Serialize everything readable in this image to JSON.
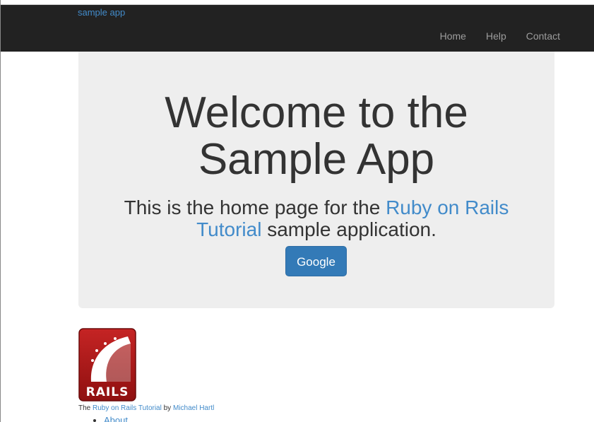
{
  "navbar": {
    "brand": "sample app",
    "links": [
      {
        "label": "Home"
      },
      {
        "label": "Help"
      },
      {
        "label": "Contact"
      }
    ]
  },
  "jumbotron": {
    "heading_line1": "Welcome to the",
    "heading_line2": "Sample App",
    "sub_prefix": "This is the home page for the ",
    "sub_link": "Ruby on Rails Tutorial",
    "sub_suffix": " sample application.",
    "button_label": "Google"
  },
  "logo": {
    "text": "RAILS"
  },
  "footer": {
    "prefix": "The ",
    "tutorial_link": "Ruby on Rails Tutorial",
    "by": " by ",
    "author_link": "Michael Hartl",
    "list": [
      {
        "label": "About"
      }
    ]
  },
  "colors": {
    "navbar_bg": "#222222",
    "link": "#428bca",
    "jumbotron_bg": "#eeeeee",
    "button": "#337ab7"
  }
}
